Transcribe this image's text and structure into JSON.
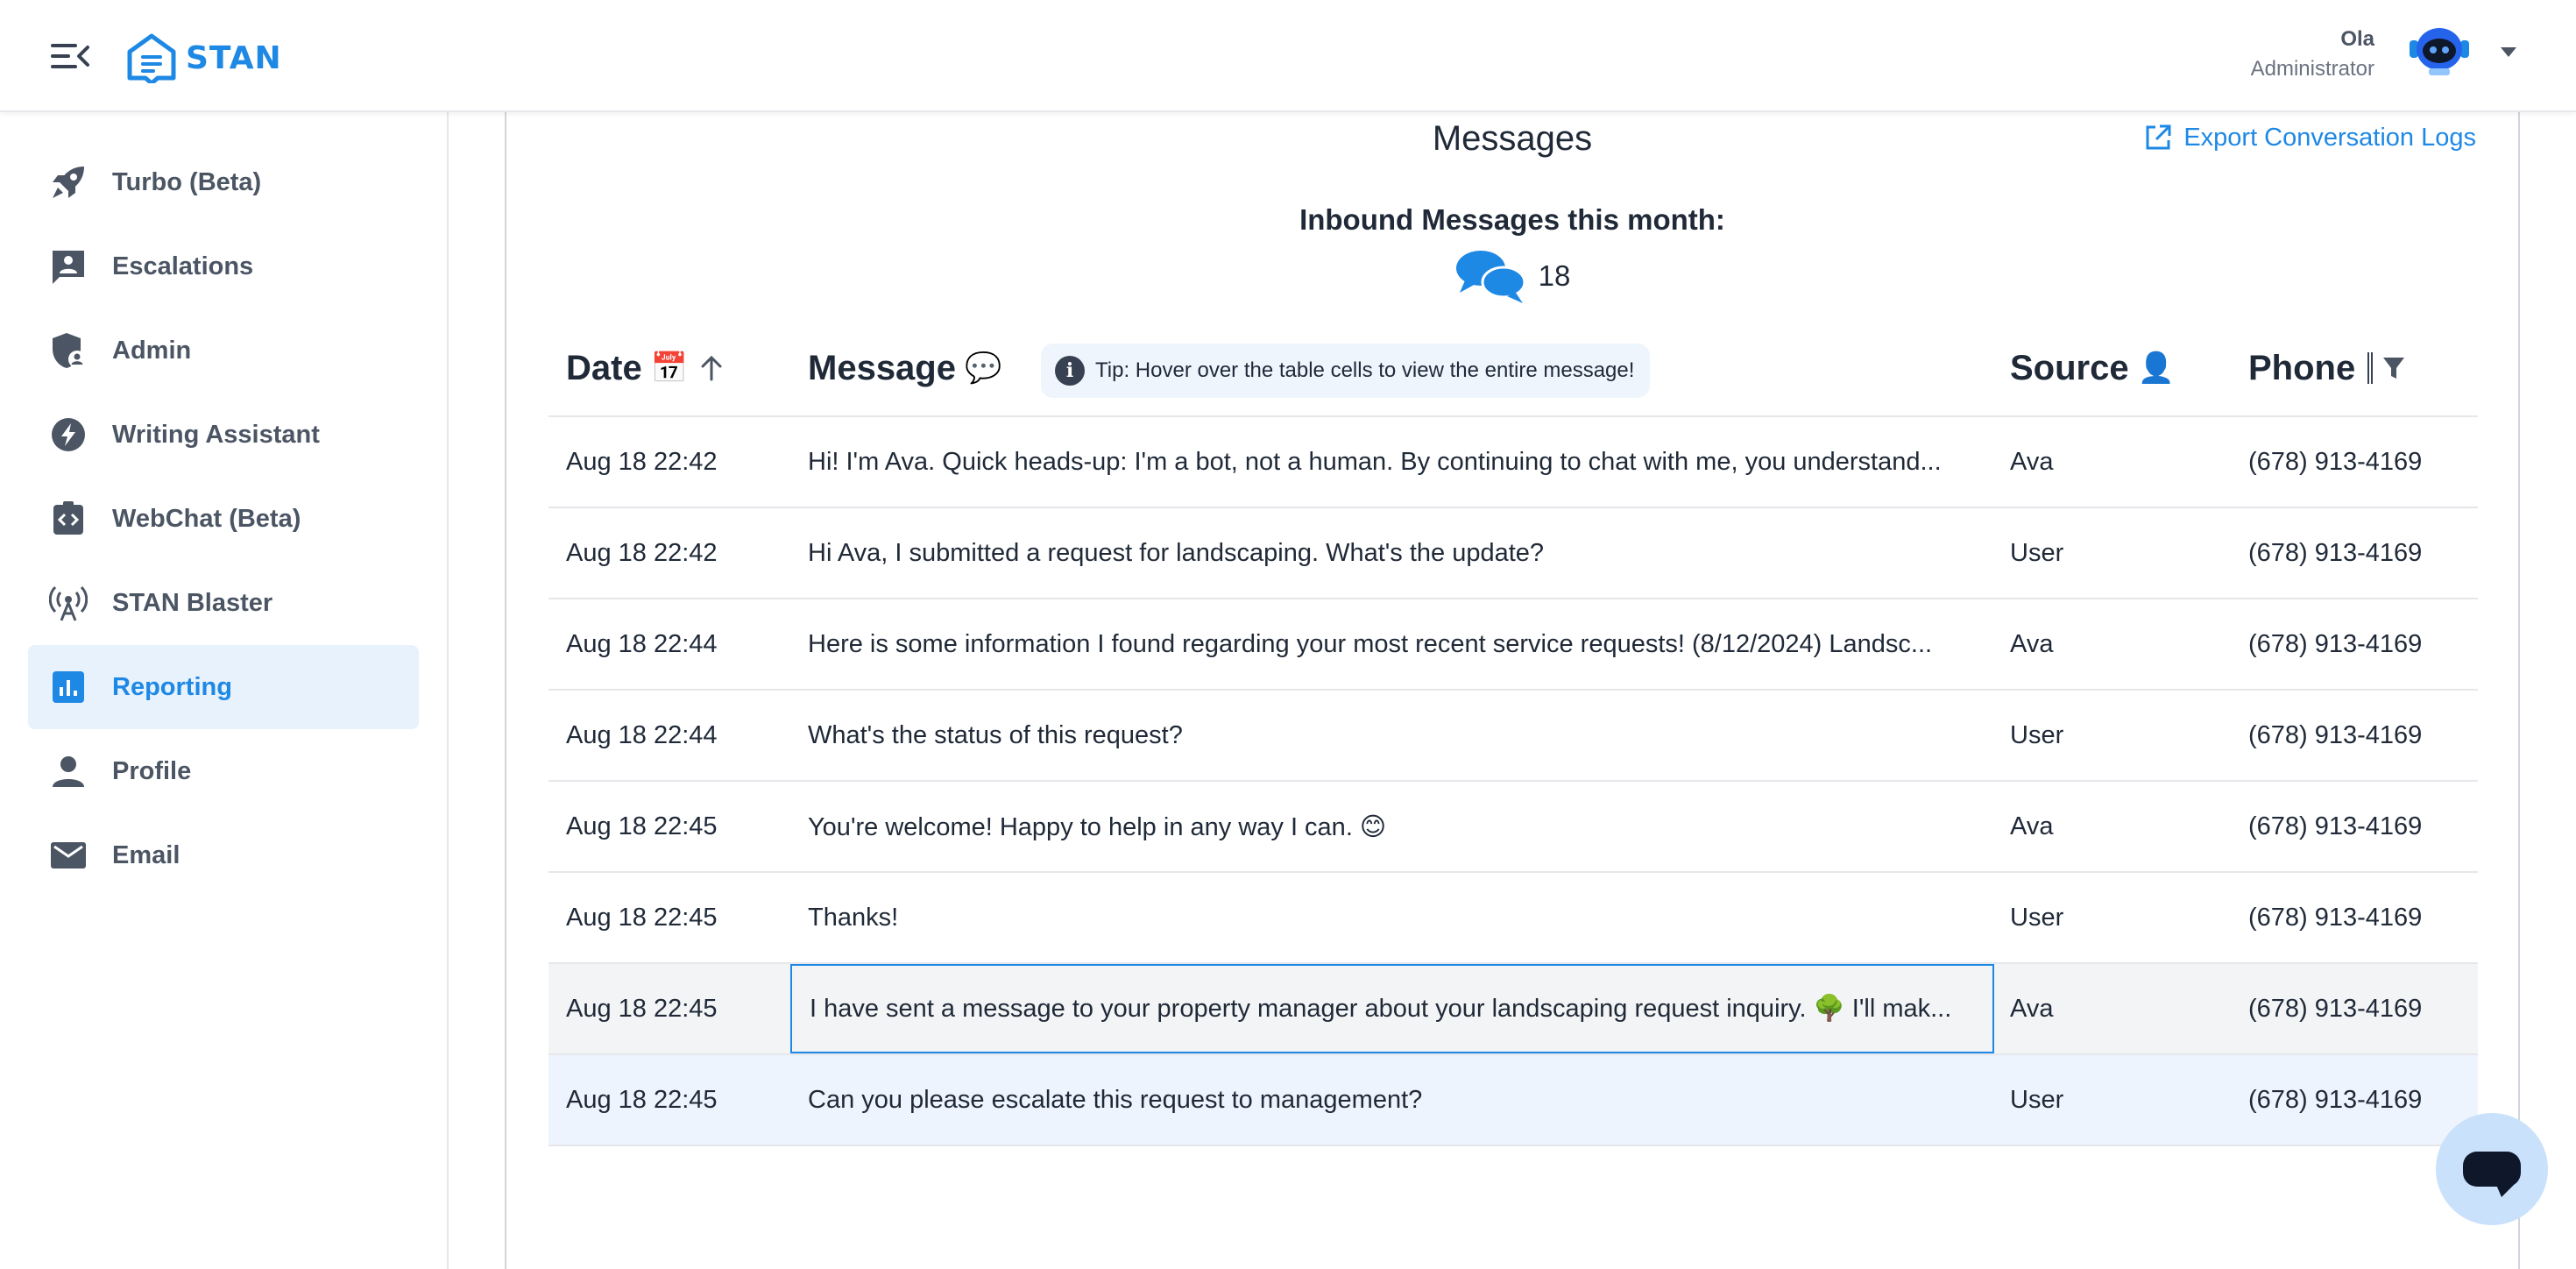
{
  "app": {
    "logo_text": "STAN",
    "brand_color": "#1e88e5"
  },
  "user": {
    "name": "Ola",
    "role": "Administrator"
  },
  "sidebar": {
    "items": [
      {
        "label": "Turbo (Beta)",
        "icon": "rocket-icon"
      },
      {
        "label": "Escalations",
        "icon": "escalation-icon"
      },
      {
        "label": "Admin",
        "icon": "admin-shield-icon"
      },
      {
        "label": "Writing Assistant",
        "icon": "lightning-icon"
      },
      {
        "label": "WebChat (Beta)",
        "icon": "code-badge-icon"
      },
      {
        "label": "STAN Blaster",
        "icon": "broadcast-icon"
      },
      {
        "label": "Reporting",
        "icon": "bar-chart-icon",
        "active": true
      },
      {
        "label": "Profile",
        "icon": "person-icon"
      },
      {
        "label": "Email",
        "icon": "mail-icon"
      }
    ]
  },
  "main": {
    "title": "Messages",
    "export_label": "Export Conversation Logs",
    "inbound_title": "Inbound Messages this month:",
    "inbound_count": "18",
    "tip": "Tip: Hover over the table cells to view the entire message!"
  },
  "table": {
    "headers": {
      "date": "Date",
      "date_icon": "📅",
      "message": "Message",
      "message_icon": "💬",
      "source": "Source",
      "source_icon": "👤",
      "phone": "Phone"
    },
    "rows": [
      {
        "date": "Aug 18 22:42",
        "message": "Hi! I'm Ava. Quick heads-up: I'm a bot, not a human. By continuing to chat with me, you understand...",
        "source": "Ava",
        "phone": "(678) 913-4169"
      },
      {
        "date": "Aug 18 22:42",
        "message": "Hi Ava, I submitted a request for landscaping. What's the update?",
        "source": "User",
        "phone": "(678) 913-4169"
      },
      {
        "date": "Aug 18 22:44",
        "message": "Here is some information I found regarding your most recent service requests! (8/12/2024) Landsc...",
        "source": "Ava",
        "phone": "(678) 913-4169"
      },
      {
        "date": "Aug 18 22:44",
        "message": "What's the status of this request?",
        "source": "User",
        "phone": "(678) 913-4169"
      },
      {
        "date": "Aug 18 22:45",
        "message": "You're welcome! Happy to help in any way I can. 😊",
        "source": "Ava",
        "phone": "(678) 913-4169"
      },
      {
        "date": "Aug 18 22:45",
        "message": "Thanks!",
        "source": "User",
        "phone": "(678) 913-4169"
      },
      {
        "date": "Aug 18 22:45",
        "message": "I have sent a message to your property manager about your landscaping request inquiry. 🌳 I'll mak...",
        "source": "Ava",
        "phone": "(678) 913-4169"
      },
      {
        "date": "Aug 18 22:45",
        "message": "Can you please escalate this request to management?",
        "source": "User",
        "phone": "(678) 913-4169"
      }
    ]
  }
}
